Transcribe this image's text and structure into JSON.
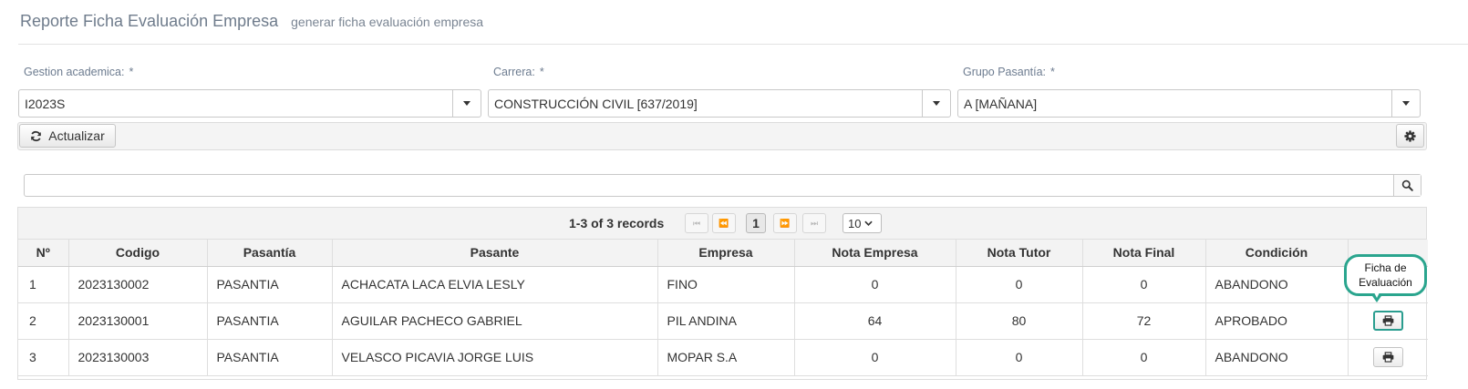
{
  "header": {
    "title": "Reporte Ficha Evaluación Empresa",
    "subtitle": "generar ficha evaluación empresa"
  },
  "filters": {
    "gestion": {
      "label": "Gestion academica:",
      "required": "*",
      "value": "I2023S"
    },
    "carrera": {
      "label": "Carrera:",
      "required": "*",
      "value": "CONSTRUCCIÓN CIVIL [637/2019]"
    },
    "grupo": {
      "label": "Grupo Pasantía:",
      "required": "*",
      "value": "A [MAÑANA]"
    }
  },
  "toolbar": {
    "refresh_label": "Actualizar",
    "refresh_icon": "refresh-icon",
    "settings_icon": "gear-icon"
  },
  "search": {
    "value": "",
    "icon": "search-icon"
  },
  "pager": {
    "records": "1-3 of 3 records",
    "current_page": "1",
    "rows_per_page": "10",
    "first": "⏮",
    "prev": "⏪",
    "next": "⏩",
    "last": "⏭"
  },
  "table": {
    "headers": [
      "Nº",
      "Codigo",
      "Pasantía",
      "Pasante",
      "Empresa",
      "Nota Empresa",
      "Nota Tutor",
      "Nota Final",
      "Condición",
      ""
    ],
    "rows": [
      {
        "n": "1",
        "codigo": "2023130002",
        "pasantia": "PASANTIA",
        "pasante": "ACHACATA LACA ELVIA LESLY",
        "empresa": "FINO",
        "nota_empresa": "0",
        "nota_tutor": "0",
        "nota_final": "0",
        "condicion": "ABANDONO"
      },
      {
        "n": "2",
        "codigo": "2023130001",
        "pasantia": "PASANTIA",
        "pasante": "AGUILAR PACHECO GABRIEL",
        "empresa": "PIL ANDINA",
        "nota_empresa": "64",
        "nota_tutor": "80",
        "nota_final": "72",
        "condicion": "APROBADO"
      },
      {
        "n": "3",
        "codigo": "2023130003",
        "pasantia": "PASANTIA",
        "pasante": "VELASCO PICAVIA JORGE LUIS",
        "empresa": "MOPAR S.A",
        "nota_empresa": "0",
        "nota_tutor": "0",
        "nota_final": "0",
        "condicion": "ABANDONO"
      }
    ]
  },
  "tooltip": {
    "line1": "Ficha de",
    "line2": "Evaluación"
  },
  "colors": {
    "accent": "#2aa58e",
    "header_text": "#6f7c8c",
    "label_text": "#6d7c90"
  }
}
